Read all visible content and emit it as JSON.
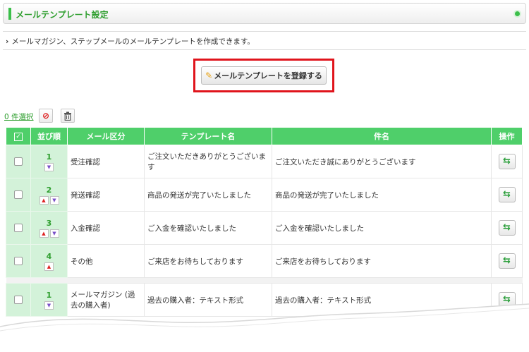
{
  "header": {
    "title": "メールテンプレート設定"
  },
  "description": "メールマガジン、ステップメールのメールテンプレートを作成できます。",
  "register_button": "メールテンプレートを登録する",
  "selection": {
    "count_label": "0 件選択"
  },
  "table": {
    "headers": {
      "order": "並び順",
      "category": "メール区分",
      "template_name": "テンプレート名",
      "subject": "件名",
      "action": "操作"
    },
    "rows": [
      {
        "order": "1",
        "category": "受注確認",
        "template_name": "ご注文いただきありがとうございます",
        "subject": "ご注文いただき誠にありがとうございます",
        "up": false,
        "down": true
      },
      {
        "order": "2",
        "category": "発送確認",
        "template_name": "商品の発送が完了いたしました",
        "subject": "商品の発送が完了いたしました",
        "up": true,
        "down": true
      },
      {
        "order": "3",
        "category": "入金確認",
        "template_name": "ご入金を確認いたしました",
        "subject": "ご入金を確認いたしました",
        "up": true,
        "down": true
      },
      {
        "order": "4",
        "category": "その他",
        "template_name": "ご来店をお待ちしております",
        "subject": "ご来店をお待ちしております",
        "up": true,
        "down": false
      },
      {
        "order": "1",
        "category": "メールマガジン (過去の購入者)",
        "template_name": "過去の購入者：テキスト形式",
        "subject": "過去の購入者：テキスト形式",
        "up": false,
        "down": true
      }
    ]
  },
  "colors": {
    "accent": "#4fcf6a",
    "order_bg": "#d3f2d9",
    "highlight": "#e0141c",
    "title_green": "#2e9e2e"
  },
  "icons": {
    "edit": "pencil-icon",
    "deselect": "no-entry-icon",
    "delete": "trash-icon",
    "action": "copy-arrow-icon"
  }
}
